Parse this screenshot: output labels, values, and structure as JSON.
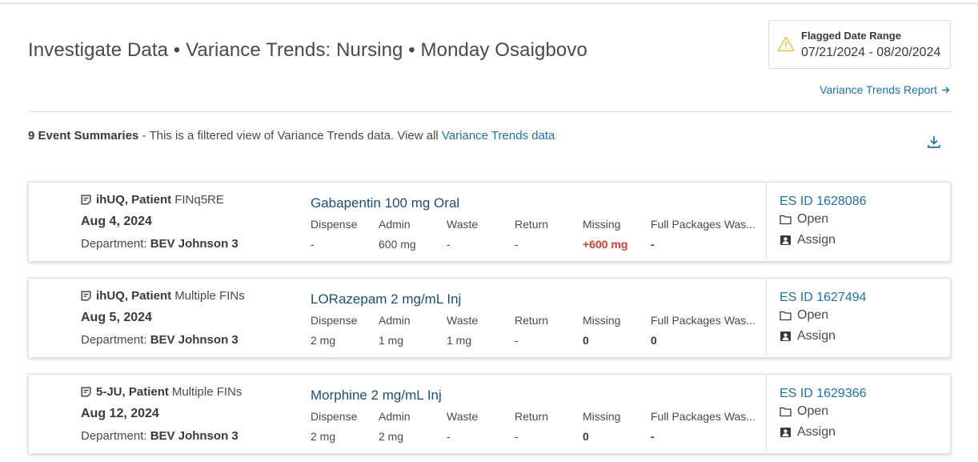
{
  "header": {
    "title": "Investigate Data • Variance Trends: Nursing • Monday Osaigbovo",
    "flag_label": "Flagged Date Range",
    "flag_value": "07/21/2024 - 08/20/2024",
    "report_link": "Variance Trends Report"
  },
  "summary": {
    "count_label": "9 Event Summaries",
    "text": " - This is a filtered view of Variance Trends data. View all ",
    "link": "Variance Trends data"
  },
  "columns": [
    "Dispense",
    "Admin",
    "Waste",
    "Return",
    "Missing",
    "Full Packages Was..."
  ],
  "actions": {
    "open": "Open",
    "assign": "Assign"
  },
  "events": [
    {
      "patient": "ihUQ, Patient",
      "fin": "FINq5RE",
      "date": "Aug 4, 2024",
      "dept_label": "Department:",
      "dept": "BEV Johnson 3",
      "med": "Gabapentin 100 mg Oral",
      "values": [
        "-",
        "600 mg",
        "-",
        "-",
        "+600 mg",
        "-"
      ],
      "missing_status": "red",
      "es_id": "ES ID 1628086"
    },
    {
      "patient": "ihUQ, Patient",
      "fin": "Multiple FINs",
      "date": "Aug 5, 2024",
      "dept_label": "Department:",
      "dept": "BEV Johnson 3",
      "med": "LORazepam 2 mg/mL Inj",
      "values": [
        "2 mg",
        "1 mg",
        "1 mg",
        "-",
        "0",
        "0"
      ],
      "missing_status": "bold",
      "es_id": "ES ID 1627494"
    },
    {
      "patient": "5-JU, Patient",
      "fin": "Multiple FINs",
      "date": "Aug 12, 2024",
      "dept_label": "Department:",
      "dept": "BEV Johnson 3",
      "med": "Morphine 2 mg/mL Inj",
      "values": [
        "2 mg",
        "2 mg",
        "-",
        "-",
        "0",
        "-"
      ],
      "missing_status": "bold",
      "es_id": "ES ID 1629366"
    }
  ],
  "colors": {
    "link": "#1d72a8",
    "med": "#1b4f7a",
    "alert": "#d93a2b",
    "warning": "#e8c547"
  },
  "icons": [
    "warning-icon",
    "arrow-right-icon",
    "download-icon",
    "note-icon",
    "folder-icon",
    "assign-icon"
  ]
}
